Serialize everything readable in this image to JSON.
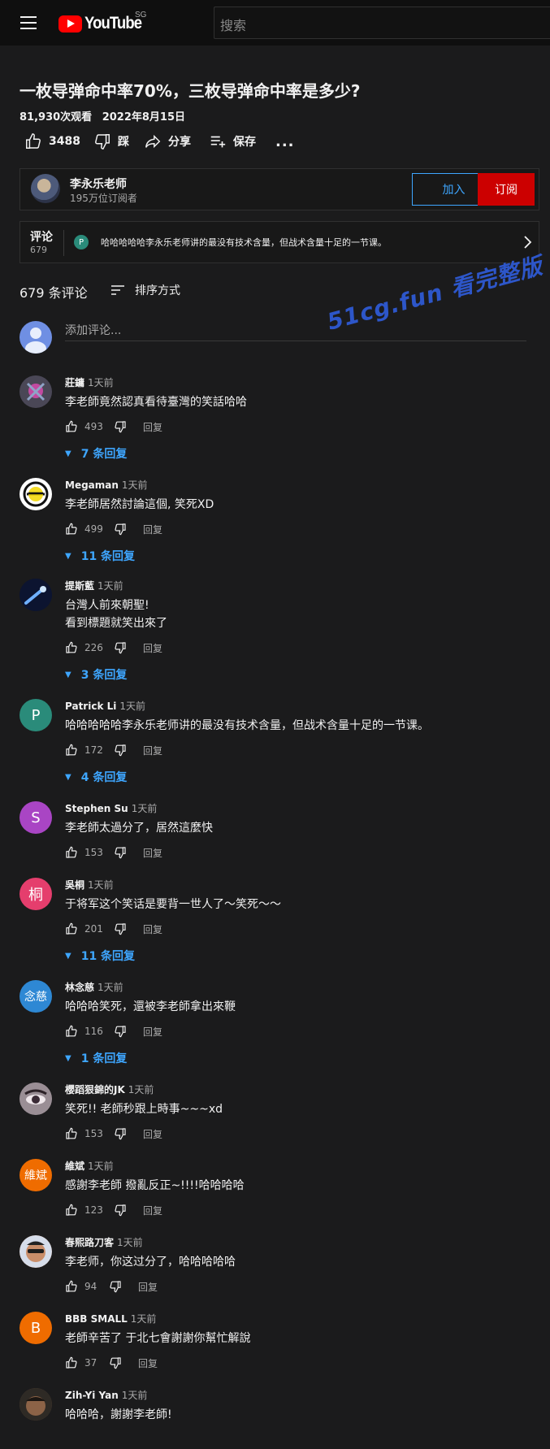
{
  "masthead": {
    "logo_text": "YouTube",
    "region": "SG",
    "search_placeholder": "搜索"
  },
  "video": {
    "title": "一枚导弹命中率70%，三枚导弹命中率是多少?",
    "views": "81,930次观看",
    "date": "2022年8月15日",
    "likes": "3488",
    "dislike_label": "踩",
    "share_label": "分享",
    "save_label": "保存",
    "more_label": "..."
  },
  "channel": {
    "name": "李永乐老师",
    "subscribers": "195万位订阅者",
    "join_label": "加入",
    "subscribe_label": "订阅"
  },
  "comments_teaser": {
    "label": "评论",
    "count": "679",
    "avatar_letter": "P",
    "text": "哈哈哈哈哈李永乐老师讲的最没有技术含量，但战术含量十足的一节课。"
  },
  "comments_header": {
    "count_label": "679 条评论",
    "sort_label": "排序方式",
    "add_placeholder": "添加评论..."
  },
  "watermark": "51cg.fun 看完整版",
  "reply_label": "回复",
  "comments": [
    {
      "author": "莊鏞",
      "time": "1天前",
      "lines": [
        "李老師竟然認真看待臺灣的笑話哈哈"
      ],
      "likes": "493",
      "replies": "7 条回复",
      "avatar_text": "",
      "avatar_color": "#3a3a44"
    },
    {
      "author": "Megaman",
      "time": "1天前",
      "lines": [
        "李老師居然討論這個, 笑死XD"
      ],
      "likes": "499",
      "replies": "11 条回复",
      "avatar_text": "",
      "avatar_color": "#ffffff"
    },
    {
      "author": "提斯藍",
      "time": "1天前",
      "lines": [
        "台灣人前來朝聖!",
        "看到標題就笑出來了"
      ],
      "likes": "226",
      "replies": "3 条回复",
      "avatar_text": "",
      "avatar_color": "#0c1430"
    },
    {
      "author": "Patrick Li",
      "time": "1天前",
      "lines": [
        "哈哈哈哈哈李永乐老师讲的最没有技术含量，但战术含量十足的一节课。"
      ],
      "likes": "172",
      "replies": "4 条回复",
      "avatar_text": "P",
      "avatar_color": "#2a8b7a"
    },
    {
      "author": "Stephen Su",
      "time": "1天前",
      "lines": [
        "李老師太過分了，居然這麼快"
      ],
      "likes": "153",
      "replies": "",
      "avatar_text": "S",
      "avatar_color": "#a945c4"
    },
    {
      "author": "吳桐",
      "time": "1天前",
      "lines": [
        "于将军这个笑话是要背一世人了～笑死～～"
      ],
      "likes": "201",
      "replies": "11 条回复",
      "avatar_text": "桐",
      "avatar_color": "#e53e6d"
    },
    {
      "author": "林念慈",
      "time": "1天前",
      "lines": [
        "哈哈哈笑死，還被李老師拿出來鞭"
      ],
      "likes": "116",
      "replies": "1 条回复",
      "avatar_text": "念慈",
      "avatar_color": "#2e88d4"
    },
    {
      "author": "櫻蹈狠錦的JK",
      "time": "1天前",
      "lines": [
        "笑死!! 老師秒跟上時事~~~xd"
      ],
      "likes": "153",
      "replies": "",
      "avatar_text": "",
      "avatar_color": "#8a7f86"
    },
    {
      "author": "維斌",
      "time": "1天前",
      "lines": [
        "感謝李老師 撥亂反正~!!!!哈哈哈哈"
      ],
      "likes": "123",
      "replies": "",
      "avatar_text": "維斌",
      "avatar_color": "#ef6c00"
    },
    {
      "author": "春熙路刀客",
      "time": "1天前",
      "lines": [
        "李老师，你这过分了，哈哈哈哈哈"
      ],
      "likes": "94",
      "replies": "",
      "avatar_text": "",
      "avatar_color": "#c98e6a"
    },
    {
      "author": "BBB SMALL",
      "time": "1天前",
      "lines": [
        "老師辛苦了  于北七會謝謝你幫忙解說"
      ],
      "likes": "37",
      "replies": "",
      "avatar_text": "B",
      "avatar_color": "#ef6c00"
    },
    {
      "author": "Zih-Yi Yan",
      "time": "1天前",
      "lines": [
        "哈哈哈，謝謝李老師!"
      ],
      "likes": "",
      "replies": "",
      "avatar_text": "",
      "avatar_color": "#5a4634"
    }
  ]
}
